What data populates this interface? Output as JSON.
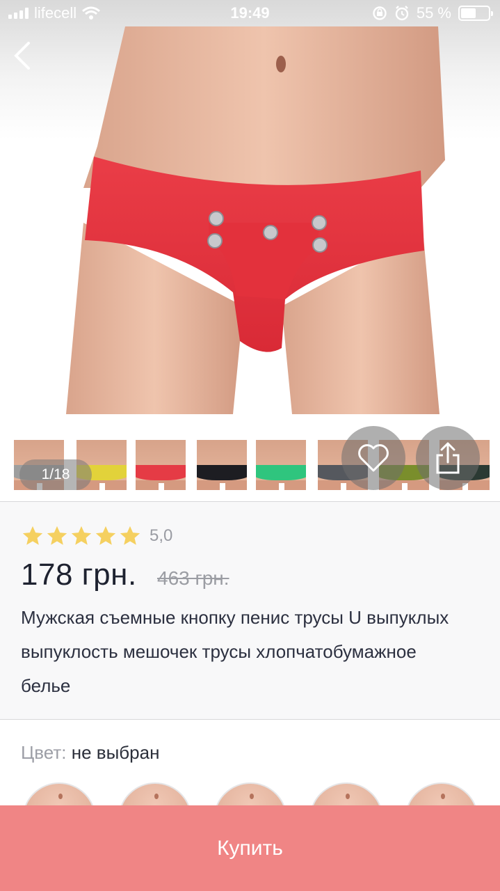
{
  "status_bar": {
    "carrier": "lifecell",
    "time": "19:49",
    "battery_text": "55 %",
    "battery_level": 0.55,
    "icons": [
      "signal-icon",
      "wifi-icon",
      "rotation-lock-icon",
      "alarm-icon",
      "battery-icon"
    ]
  },
  "gallery": {
    "counter": "1/18",
    "thumbnail_colors": [
      "#9e9e9e",
      "#e2d23a",
      "#e53b45",
      "#1d1d22",
      "#2fc57e",
      "#55585e",
      "#7a8e2c",
      "#2b3a33"
    ]
  },
  "product": {
    "rating_stars": 5,
    "rating_value": "5,0",
    "price": "178 грн.",
    "old_price": "463 грн.",
    "title": "Мужская съемные кнопку пенис трусы U выпуклых выпуклость мешочек трусы хлопчатобумажное белье"
  },
  "color": {
    "label": "Цвет:",
    "value": "не выбран"
  },
  "buy_button": {
    "label": "Купить"
  },
  "colors": {
    "accent": "#f08585",
    "star": "#f5d060",
    "product_red": "#e5353f"
  }
}
